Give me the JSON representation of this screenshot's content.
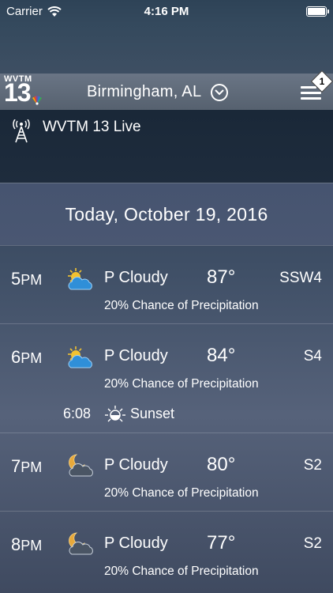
{
  "status": {
    "carrier": "Carrier",
    "time": "4:16 PM"
  },
  "header": {
    "logo_call": "WVTM",
    "logo_num": "13",
    "location": "Birmingham, AL",
    "notification_count": "1"
  },
  "live": {
    "label": "WVTM 13 Live"
  },
  "date_heading": "Today, October 19, 2016",
  "hours": [
    {
      "hour": "5",
      "ampm": "PM",
      "condition": "P Cloudy",
      "temp": "87°",
      "wind": "SSW4",
      "precip": "20% Chance of Precipitation",
      "icon": "partly-cloudy-day-icon"
    },
    {
      "hour": "6",
      "ampm": "PM",
      "condition": "P Cloudy",
      "temp": "84°",
      "wind": "S4",
      "precip": "20% Chance of Precipitation",
      "icon": "partly-cloudy-day-icon",
      "sunset_time": "6:08",
      "sunset_label": "Sunset"
    },
    {
      "hour": "7",
      "ampm": "PM",
      "condition": "P Cloudy",
      "temp": "80°",
      "wind": "S2",
      "precip": "20% Chance of Precipitation",
      "icon": "partly-cloudy-night-icon"
    },
    {
      "hour": "8",
      "ampm": "PM",
      "condition": "P Cloudy",
      "temp": "77°",
      "wind": "S2",
      "precip": "20% Chance of Precipitation",
      "icon": "partly-cloudy-night-icon"
    }
  ],
  "colors": {
    "sun": "#f2c230",
    "cloud_day": "#2f8fd8",
    "cloud_night": "#4a5564",
    "moon": "#e8a93a"
  }
}
